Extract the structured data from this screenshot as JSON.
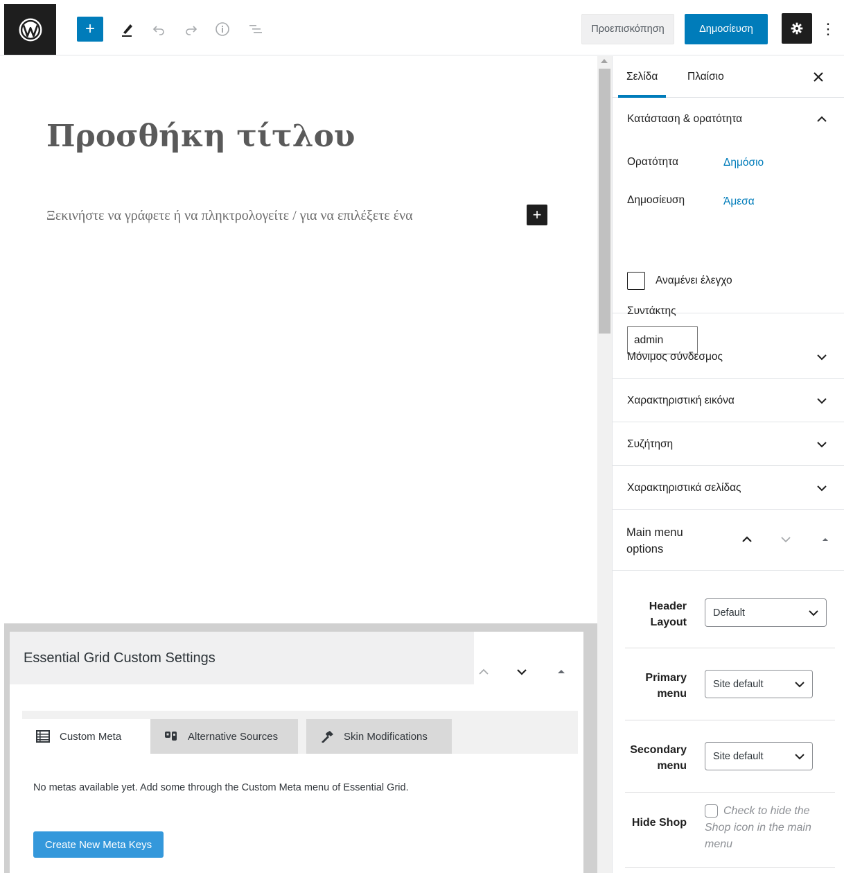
{
  "toolbar": {
    "preview_label": "Προεπισκόπηση",
    "publish_label": "Δημοσίευση",
    "add_symbol": "+",
    "more_symbol": "⋮"
  },
  "editor": {
    "title_placeholder": "Προσθήκη τίτλου",
    "paragraph_placeholder": "Ξεκινήστε να γράφετε ή να πληκτρολογείτε / για να επιλέξετε ένα",
    "inline_add_symbol": "+"
  },
  "sidebar": {
    "tabs": [
      {
        "label": "Σελίδα",
        "active": true
      },
      {
        "label": "Πλαίσιο",
        "active": false
      }
    ],
    "status_panel": {
      "title": "Κατάσταση & ορατότητα",
      "visibility_label": "Ορατότητα",
      "visibility_value": "Δημόσιο",
      "publish_label": "Δημοσίευση",
      "publish_value": "Άμεσα",
      "pending_label": "Αναμένει έλεγχο",
      "author_label": "Συντάκτης",
      "author_value": "admin"
    },
    "panels": [
      {
        "title": "Μόνιμος σύνδεσμος"
      },
      {
        "title": "Χαρακτηριστική εικόνα"
      },
      {
        "title": "Συζήτηση"
      },
      {
        "title": "Χαρακτηριστικά σελίδας"
      }
    ],
    "main_menu": {
      "title": "Main menu options",
      "options": [
        {
          "label": "Header Layout",
          "value": "Default"
        },
        {
          "label": "Primary menu",
          "value": "Site default"
        },
        {
          "label": "Secondary menu",
          "value": "Site default"
        },
        {
          "label": "Hide Shop",
          "checkbox_text": "Check to hide the Shop icon in the main menu"
        }
      ]
    }
  },
  "metabox": {
    "title": "Essential Grid Custom Settings",
    "tabs": [
      {
        "label": "Custom Meta",
        "icon": "table-icon"
      },
      {
        "label": "Alternative Sources",
        "icon": "sources-icon"
      },
      {
        "label": "Skin Modifications",
        "icon": "hammer-icon"
      }
    ],
    "note": "No metas available yet. Add some through the Custom Meta menu of Essential Grid.",
    "button_label": "Create New Meta Keys"
  },
  "colors": {
    "accent": "#007cba",
    "dark": "#1e1e1e",
    "meta_button": "#3498db"
  }
}
